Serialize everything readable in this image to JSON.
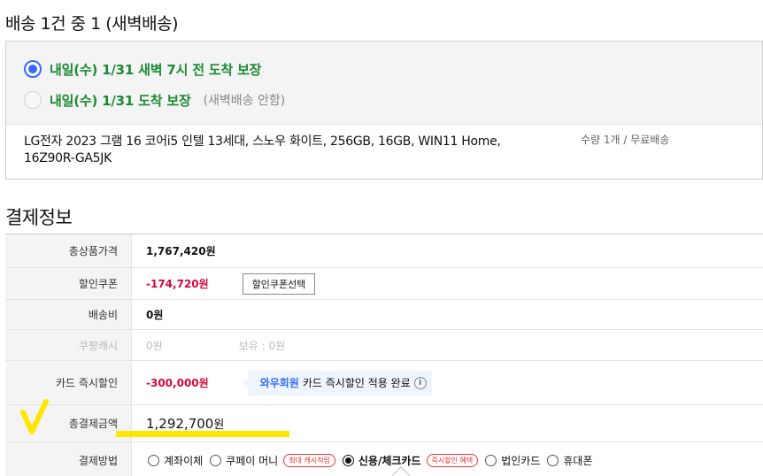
{
  "delivery": {
    "title": "배송 1건 중 1 (새벽배송)",
    "options": [
      {
        "label": "내일(수) 1/31 새벽 7시 전 도착 보장",
        "note": ""
      },
      {
        "label": "내일(수) 1/31 도착 보장",
        "note": "(새벽배송 안함)"
      }
    ],
    "selected_index": 0,
    "product": {
      "name": "LG전자 2023 그램 16 코어i5 인텔 13세대, 스노우 화이트, 256GB, 16GB, WIN11 Home, 16Z90R-GA5JK",
      "qty_shipping": "수량 1개 / 무료배송"
    }
  },
  "payment": {
    "title": "결제정보",
    "rows": {
      "total_price": {
        "label": "총상품가격",
        "value": "1,767,420원"
      },
      "coupon": {
        "label": "할인쿠폰",
        "value": "-174,720원",
        "button": "할인쿠폰선택"
      },
      "shipping": {
        "label": "배송비",
        "value": "0원"
      },
      "cash": {
        "label": "쿠팡캐시",
        "value": "0원",
        "holding": "보유 : 0원"
      },
      "card_discount": {
        "label": "카드 즉시할인",
        "value": "-300,000원",
        "wow": "와우회원",
        "wow_msg": "카드 즉시할인 적용 완료",
        "info_glyph": "i"
      },
      "grand_total": {
        "label": "총결제금액",
        "amount": "1,292,700",
        "unit": "원"
      },
      "method": {
        "label": "결제방법",
        "options": [
          {
            "label": "계좌이체",
            "tag": ""
          },
          {
            "label": "쿠페이 머니",
            "tag": "최대 캐시적립"
          },
          {
            "label": "신용/체크카드",
            "tag": "즉시할인 혜택"
          },
          {
            "label": "법인카드",
            "tag": ""
          },
          {
            "label": "휴대폰",
            "tag": ""
          }
        ],
        "selected_index": 2
      }
    }
  },
  "colors": {
    "accent": "#346aff",
    "green": "#1b8a32",
    "discount_red": "#d3083e",
    "highlight": "#ffe600"
  }
}
